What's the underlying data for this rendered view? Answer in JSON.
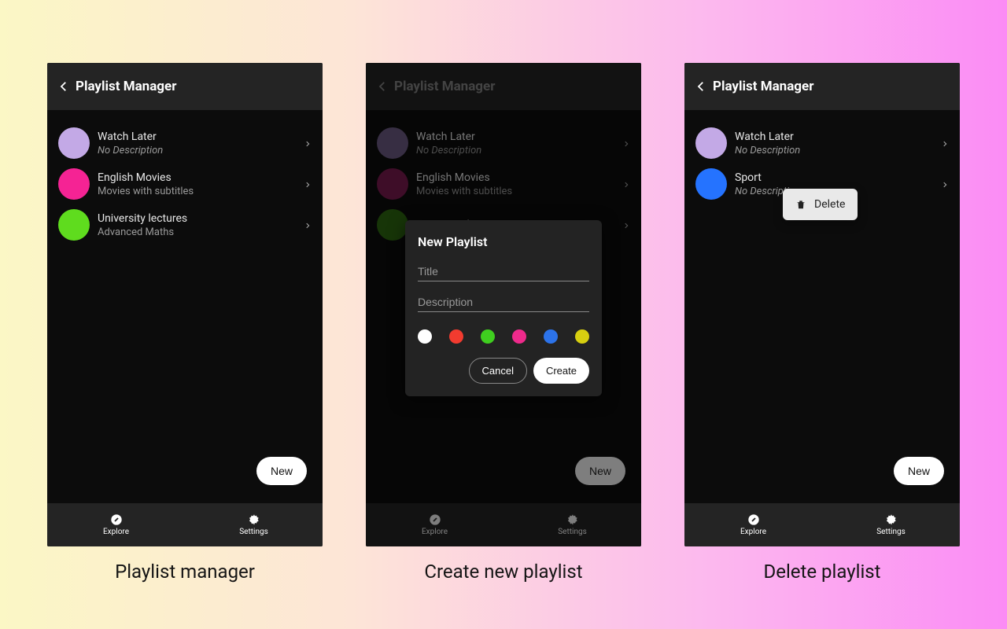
{
  "header_title": "Playlist Manager",
  "new_label": "New",
  "tabs": {
    "explore": "Explore",
    "settings": "Settings"
  },
  "captions": {
    "screen1": "Playlist manager",
    "screen2": "Create new playlist",
    "screen3": "Delete playlist"
  },
  "colors": {
    "lilac": "#c3a9e6",
    "pink": "#f52394",
    "green": "#5fdc1e",
    "blue": "#2573ff",
    "dim_lilac": "#6f5c86",
    "dim_pink": "#7d1b50",
    "dim_green": "#2f6a10"
  },
  "screen1": {
    "items": [
      {
        "title": "Watch Later",
        "desc": "No Description",
        "italic": true,
        "colorKey": "lilac"
      },
      {
        "title": "English Movies",
        "desc": "Movies with subtitles",
        "italic": false,
        "colorKey": "pink"
      },
      {
        "title": "University lectures",
        "desc": "Advanced Maths",
        "italic": false,
        "colorKey": "green"
      }
    ]
  },
  "screen2": {
    "items": [
      {
        "title": "Watch Later",
        "desc": "No Description",
        "italic": true,
        "colorKey": "dim_lilac"
      },
      {
        "title": "English Movies",
        "desc": "Movies with subtitles",
        "italic": false,
        "colorKey": "dim_pink"
      },
      {
        "title": "University lectures",
        "desc": "",
        "italic": false,
        "colorKey": "dim_green"
      }
    ],
    "dialog": {
      "title": "New Playlist",
      "title_placeholder": "Title",
      "desc_placeholder": "Description",
      "cancel": "Cancel",
      "create": "Create",
      "swatches": [
        "#ffffff",
        "#f23b2f",
        "#3fce1f",
        "#ee2a8b",
        "#2c73ea",
        "#d7cf10"
      ]
    }
  },
  "screen3": {
    "items": [
      {
        "title": "Watch Later",
        "desc": "No Description",
        "italic": true,
        "colorKey": "lilac"
      },
      {
        "title": "Sport",
        "desc": "No Description",
        "italic": true,
        "colorKey": "blue"
      }
    ],
    "context_menu": {
      "label": "Delete"
    }
  }
}
